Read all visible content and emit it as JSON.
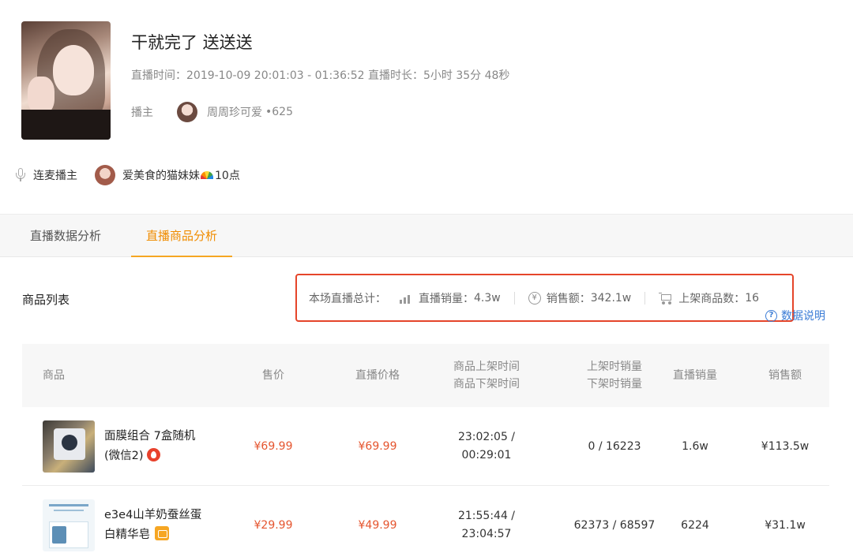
{
  "header": {
    "title": "干就完了 送送送",
    "live_time_label": "直播时间：",
    "live_time": "2019-10-09 20:01:03 - 01:36:52",
    "duration_label": "直播时长：",
    "duration": "5小时 35分 48秒",
    "anchor_label": "播主",
    "anchor_name": "周周珍可爱",
    "anchor_level": "•625"
  },
  "guest": {
    "label": "连麦播主",
    "name": "爱美食的猫妹妹",
    "score": "10点"
  },
  "tabs": [
    {
      "label": "直播数据分析",
      "active": false
    },
    {
      "label": "直播商品分析",
      "active": true
    }
  ],
  "product_list": {
    "title": "商品列表",
    "summary_label": "本场直播总计：",
    "live_sales_label": "直播销量：",
    "live_sales": "4.3w",
    "revenue_label": "销售额：",
    "revenue": "342.1w",
    "listed_count_label": "上架商品数：",
    "listed_count": "16",
    "explain_link": "数据说明"
  },
  "table": {
    "headers": {
      "product": "商品",
      "price": "售价",
      "live_price": "直播价格",
      "time_on": "商品上架时间",
      "time_off": "商品下架时间",
      "sales_on": "上架时销量",
      "sales_off": "下架时销量",
      "live_sales": "直播销量",
      "revenue": "销售额"
    },
    "rows": [
      {
        "name_line1": "面膜组合 7盒随机",
        "name_line2": "(微信2)",
        "price": "¥69.99",
        "live_price": "¥69.99",
        "time_on": "23:02:05 /",
        "time_off": "00:29:01",
        "sales": "0 / 16223",
        "live_sales": "1.6w",
        "revenue": "¥113.5w"
      },
      {
        "name_line1": "e3e4山羊奶蚕丝蛋",
        "name_line2": "白精华皂",
        "price": "¥29.99",
        "live_price": "¥49.99",
        "time_on": "21:55:44 /",
        "time_off": "23:04:57",
        "sales": "62373 / 68597",
        "live_sales": "6224",
        "revenue": "¥31.1w"
      }
    ]
  },
  "colors": {
    "accent": "#f08c00",
    "price": "#e5552f",
    "highlight_border": "#e5452a",
    "link": "#3a7bd5"
  }
}
